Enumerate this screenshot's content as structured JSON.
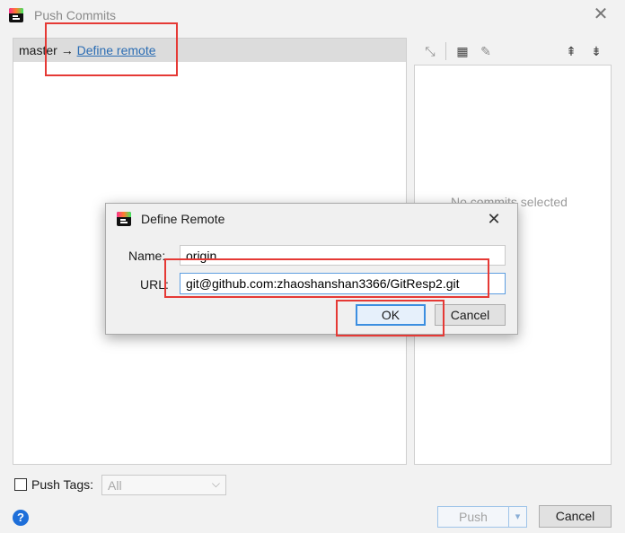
{
  "window": {
    "title": "Push Commits",
    "close_glyph": "✕"
  },
  "commits_panel": {
    "branch": "master",
    "arrow": "→",
    "define_remote_link": "Define remote"
  },
  "toolbar": {
    "icons": [
      "expand-arrows-icon",
      "group-icon",
      "edit-icon",
      "expand-all-icon",
      "collapse-all-icon"
    ]
  },
  "details_panel": {
    "empty_text": "No commits selected"
  },
  "push_tags": {
    "label": "Push Tags:",
    "checked": false,
    "select_value": "All"
  },
  "footer": {
    "help_glyph": "?",
    "push_label": "Push",
    "cancel_label": "Cancel"
  },
  "define_remote_dialog": {
    "title": "Define Remote",
    "close_glyph": "✕",
    "name_label": "Name:",
    "name_value": "origin",
    "url_label": "URL:",
    "url_value": "git@github.com:zhaoshanshan3366/GitResp2.git",
    "ok_label": "OK",
    "cancel_label": "Cancel"
  },
  "colors": {
    "link": "#2a6cb3",
    "annotation": "#e53935",
    "focus": "#3c8ee0"
  }
}
